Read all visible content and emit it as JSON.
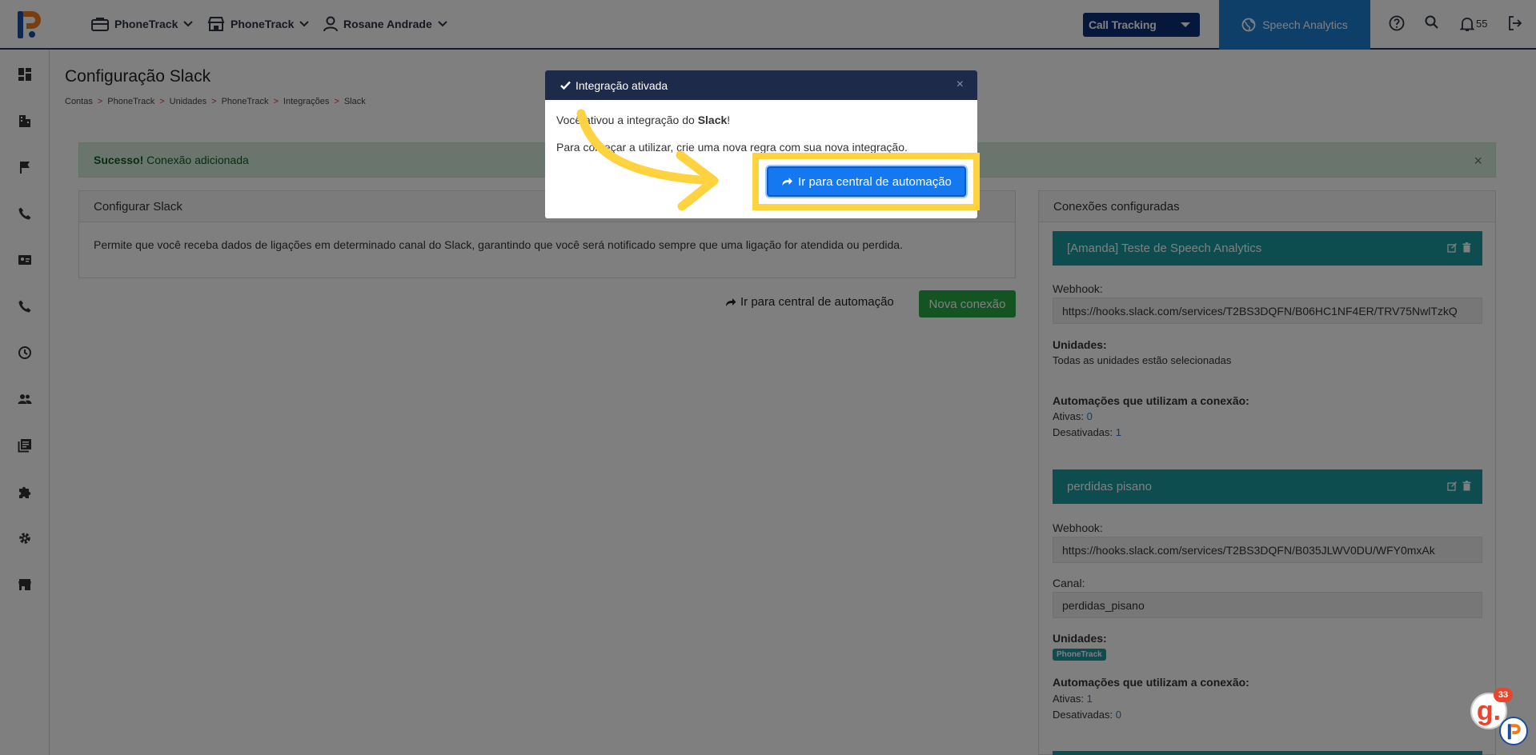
{
  "nav": {
    "account": "PhoneTrack",
    "unit": "PhoneTrack",
    "user": "Rosane Andrade"
  },
  "topbar": {
    "call_tracking": "Call Tracking",
    "speech_analytics": "Speech Analytics",
    "notifications_count": "55"
  },
  "page": {
    "title": "Configuração Slack",
    "breadcrumb": [
      "Contas",
      "PhoneTrack",
      "Unidades",
      "PhoneTrack",
      "Integrações",
      "Slack"
    ],
    "breadcrumb_sep": ">"
  },
  "alert": {
    "strong": "Sucesso!",
    "text": "Conexão adicionada",
    "close": "×"
  },
  "config_card": {
    "title": "Configurar Slack",
    "description": "Permite que você receba dados de ligações em determinado canal do Slack, garantindo que você será notificado sempre que uma ligação for atendida ou perdida."
  },
  "actions": {
    "automation_link": "Ir para central de automação",
    "new_connection": "Nova conexão"
  },
  "connections": {
    "title": "Conexões configuradas",
    "items": [
      {
        "name": "[Amanda] Teste de Speech Analytics",
        "webhook_label": "Webhook:",
        "webhook": "https://hooks.slack.com/services/T2BS3DQFN/B06HC1NF4ER/TRV75NwlTzkQ",
        "units_label": "Unidades:",
        "units_text": "Todas as unidades estão selecionadas",
        "automations_label": "Automações que utilizam a conexão:",
        "active_label": "Ativas:",
        "active_count": "0",
        "inactive_label": "Desativadas:",
        "inactive_count": "1"
      },
      {
        "name": "perdidas pisano",
        "webhook_label": "Webhook:",
        "webhook": "https://hooks.slack.com/services/T2BS3DQFN/B035JLWV0DU/WFY0mxAk",
        "channel_label": "Canal:",
        "channel": "perdidas_pisano",
        "units_label": "Unidades:",
        "unit_badge": "PhoneTrack",
        "automations_label": "Automações que utilizam a conexão:",
        "active_label": "Ativas:",
        "active_count": "1",
        "inactive_label": "Desativadas:",
        "inactive_count": "0"
      }
    ]
  },
  "modal": {
    "title": "Integração ativada",
    "close": "×",
    "line1_pre": "Você ativou a integração do ",
    "line1_strong": "Slack",
    "line1_post": "!",
    "line2": "Para começar a utilizar, crie uma nova regra com sua nova integração.",
    "button": "Ir para central de automação"
  },
  "widgets": {
    "g_letter": "g.",
    "g_count": "33"
  },
  "colors": {
    "brand_dark": "#1d2a4a",
    "primary": "#1478f0",
    "highlight": "#ffd23f",
    "teal": "#1b9aa1",
    "success": "#28a745"
  }
}
